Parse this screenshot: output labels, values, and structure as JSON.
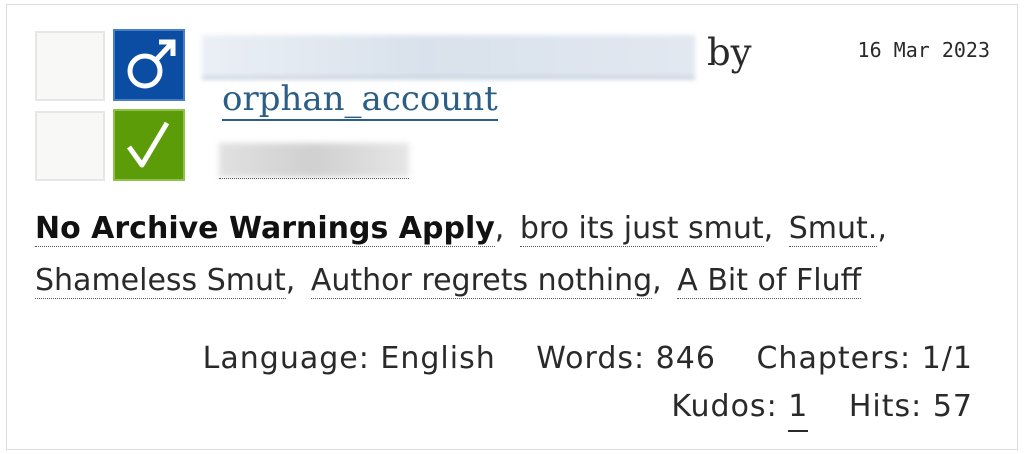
{
  "work": {
    "by": "by",
    "author": "orphan_account",
    "date": "16 Mar 2023",
    "required_tags": {
      "gender_icon": "male-symbol-icon",
      "complete_icon": "checkmark-icon",
      "gender_color": "#0b4da3",
      "complete_color": "#5b9c08"
    },
    "tags": [
      {
        "label": "No Archive Warnings Apply",
        "sep": ","
      },
      {
        "label": "bro its just smut",
        "sep": ","
      },
      {
        "label": "Smut.",
        "sep": ","
      },
      {
        "label": "Shameless Smut",
        "sep": ","
      },
      {
        "label": "Author regrets nothing",
        "sep": ","
      },
      {
        "label": "A Bit of Fluff",
        "sep": ""
      }
    ],
    "stats": {
      "language_label": "Language:",
      "language": "English",
      "words_label": "Words:",
      "words": "846",
      "chapters_label": "Chapters:",
      "chapters": "1/1",
      "kudos_label": "Kudos:",
      "kudos": "1",
      "hits_label": "Hits:",
      "hits": "57"
    }
  }
}
